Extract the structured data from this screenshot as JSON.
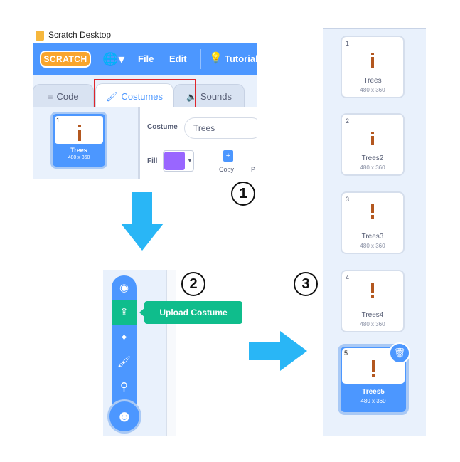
{
  "panel1": {
    "window_title": "Scratch Desktop",
    "logo_text": "SCRATCH",
    "menu": {
      "file": "File",
      "edit": "Edit",
      "tutorials": "Tutorials"
    },
    "tabs": {
      "code": "Code",
      "costumes": "Costumes",
      "sounds": "Sounds"
    },
    "thumbnail": {
      "number": "1",
      "name": "Trees",
      "size": "480 x 360"
    },
    "costume_label": "Costume",
    "costume_name": "Trees",
    "fill_label": "Fill",
    "fill_color": "#9966ff",
    "copy_label": "Copy",
    "paste_partial": "P"
  },
  "step_numbers": {
    "one": "1",
    "two": "2",
    "three": "3"
  },
  "panel2": {
    "tooltip": "Upload Costume",
    "buttons": [
      "camera-icon",
      "upload-icon",
      "surprise-icon",
      "paint-icon",
      "search-icon",
      "choose-costume-icon"
    ]
  },
  "panel3": {
    "costumes": [
      {
        "number": "1",
        "name": "Trees",
        "size": "480 x 360"
      },
      {
        "number": "2",
        "name": "Trees2",
        "size": "480 x 360"
      },
      {
        "number": "3",
        "name": "Trees3",
        "size": "480 x 360"
      },
      {
        "number": "4",
        "name": "Trees4",
        "size": "480 x 360"
      },
      {
        "number": "5",
        "name": "Trees5",
        "size": "480 x 360"
      }
    ]
  },
  "colors": {
    "scratch_blue": "#4c97ff",
    "upload_green": "#0fbd8c",
    "arrow_blue": "#29b6f6",
    "highlight_red": "#e0262b",
    "trunk_brown": "#b3571f"
  }
}
